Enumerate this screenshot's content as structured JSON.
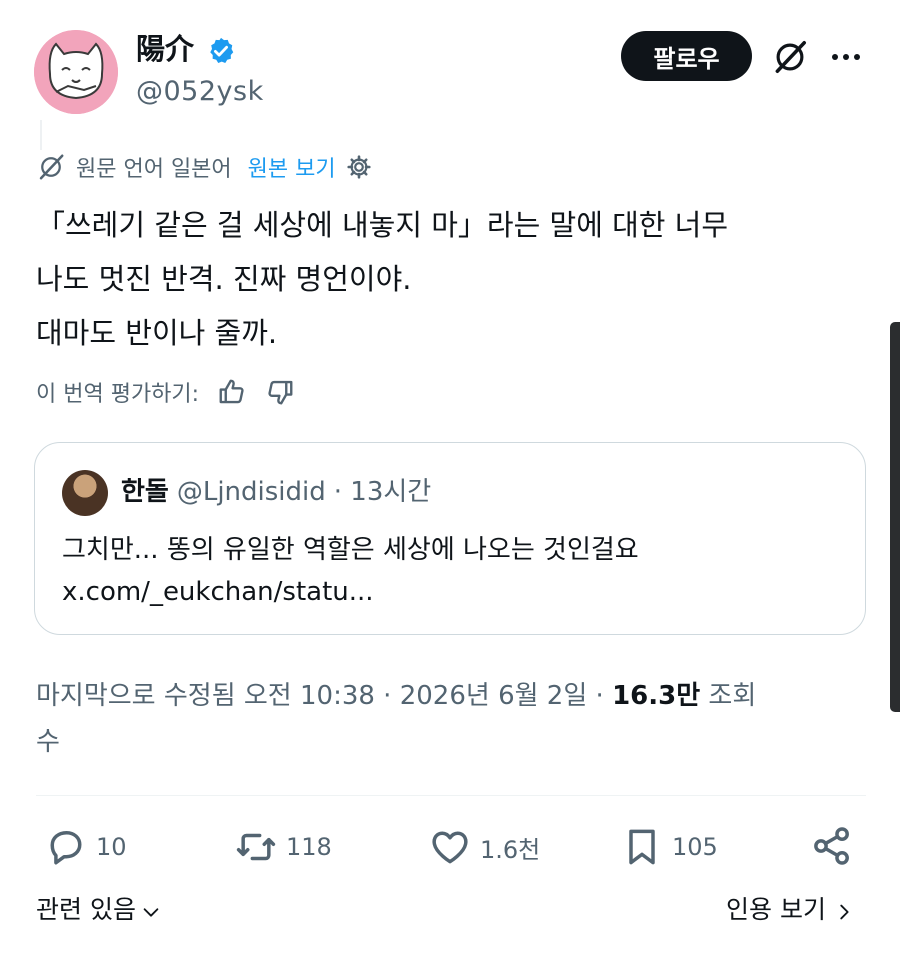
{
  "author": {
    "display_name": "陽介",
    "handle": "@052ysk",
    "verified": true,
    "follow_label": "팔로우"
  },
  "translation": {
    "source_label": "원문 언어 일본어",
    "view_original_label": "원본 보기"
  },
  "tweet": {
    "lines": [
      "「쓰레기 같은 걸 세상에 내놓지 마」라는 말에 대한 너무",
      "나도 멋진 반격. 진짜 명언이야.",
      "대마도 반이나 줄까."
    ]
  },
  "rate_translation": {
    "label": "이 번역 평가하기:"
  },
  "quote": {
    "name": "한돌",
    "handle": "@Ljndisidid",
    "time": "· 13시간",
    "text_line1": "그치만... 똥의 유일한 역할은 세상에 나오는 것인걸요",
    "text_line2": "x.com/_eukchan/statu..."
  },
  "meta": {
    "edited_prefix": "마지막으로 수정됨 오전 10:38 · 2026년 6월 2일 · ",
    "views_count": "16.3만",
    "views_suffix_a": " 조회",
    "views_suffix_b": "수"
  },
  "actions": {
    "replies": "10",
    "reposts": "118",
    "likes": "1.6천",
    "bookmarks": "105"
  },
  "footer": {
    "related_label": "관련 있음",
    "view_quotes_label": "인용 보기"
  },
  "colors": {
    "accent": "#1d9bf0",
    "text_primary": "#0f1419",
    "text_secondary": "#536471",
    "border": "#cfd9de",
    "avatar_bg": "#f2a4bb"
  },
  "icons": [
    "verified-badge-icon",
    "grok-icon",
    "more-icon",
    "translate-icon",
    "gear-icon",
    "thumbs-up-icon",
    "thumbs-down-icon",
    "reply-icon",
    "repost-icon",
    "like-icon",
    "bookmark-icon",
    "share-icon",
    "chevron-down-icon",
    "chevron-right-icon"
  ]
}
